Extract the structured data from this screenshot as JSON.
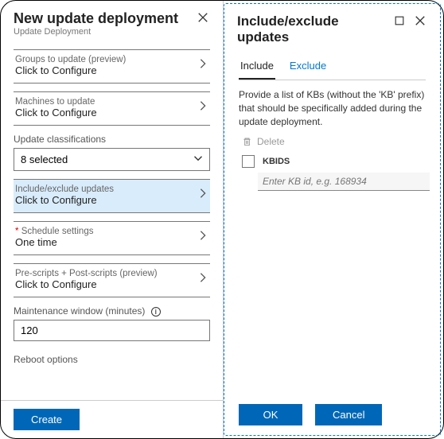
{
  "left": {
    "title": "New update deployment",
    "subtitle": "Update Deployment",
    "groups": {
      "label": "Groups to update (preview)",
      "value": "Click to Configure"
    },
    "machines": {
      "label": "Machines to update",
      "value": "Click to Configure"
    },
    "classifications": {
      "label": "Update classifications",
      "value": "8 selected"
    },
    "includeExclude": {
      "label": "Include/exclude updates",
      "value": "Click to Configure"
    },
    "schedule": {
      "label": "Schedule settings",
      "value": "One time"
    },
    "scripts": {
      "label": "Pre-scripts + Post-scripts (preview)",
      "value": "Click to Configure"
    },
    "maintenance": {
      "label": "Maintenance window (minutes)",
      "value": "120"
    },
    "reboot": {
      "label": "Reboot options"
    },
    "createBtn": "Create"
  },
  "right": {
    "title": "Include/exclude updates",
    "tabs": {
      "include": "Include",
      "exclude": "Exclude"
    },
    "description": "Provide a list of KBs (without the 'KB' prefix) that should be specifically added during the update deployment.",
    "deleteLabel": "Delete",
    "kbidsHeader": "KBIDS",
    "kbPlaceholder": "Enter KB id, e.g. 168934",
    "okBtn": "OK",
    "cancelBtn": "Cancel"
  }
}
